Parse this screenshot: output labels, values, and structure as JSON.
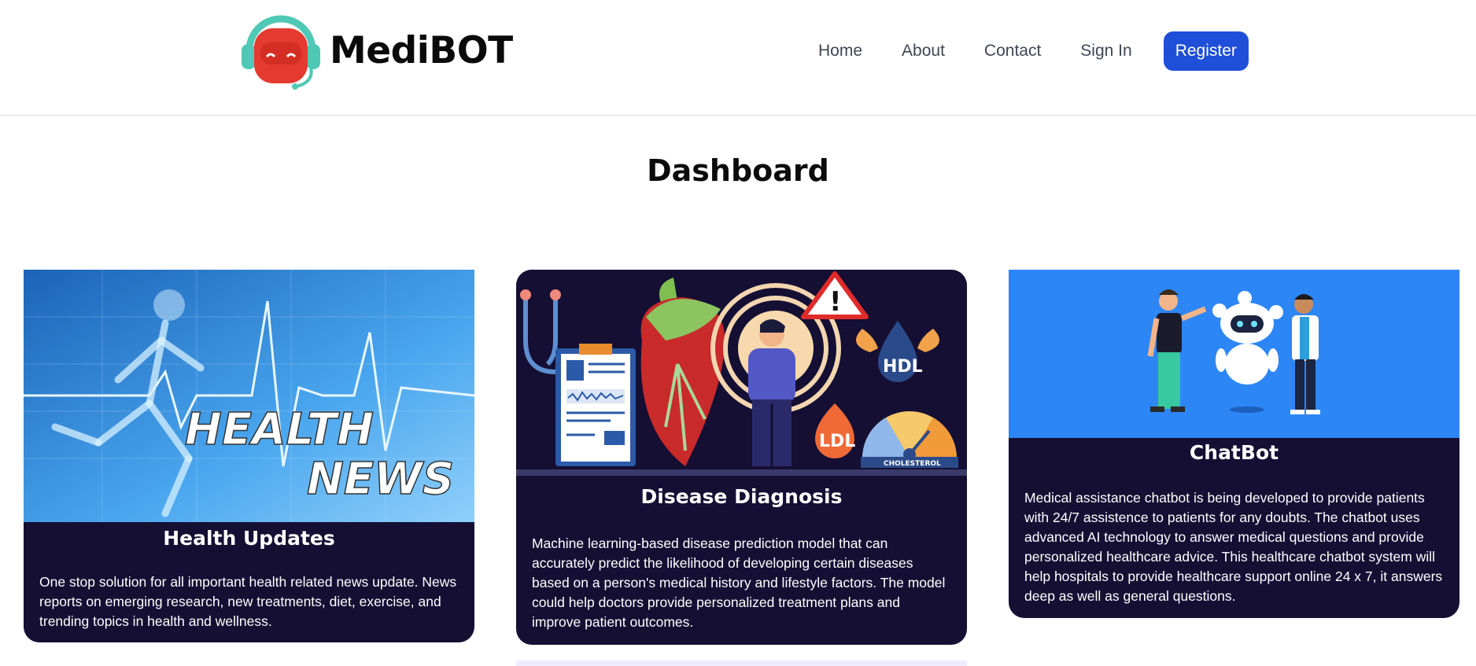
{
  "brand": {
    "name": "MediBOT",
    "logo_icon": "robot-headset-icon"
  },
  "nav": {
    "links": [
      "Home",
      "About",
      "Contact",
      "Sign In"
    ],
    "register_label": "Register",
    "register_color": "#1f4fd8"
  },
  "page": {
    "title": "Dashboard"
  },
  "cards": [
    {
      "title": "Health Updates",
      "image_text": [
        "HEALTH",
        "NEWS"
      ],
      "text": "One stop solution for all important health related news update. News reports on emerging research, new treatments, diet, exercise, and trending topics in health and wellness."
    },
    {
      "title": "Disease Diagnosis",
      "image_labels": [
        "HDL",
        "LDL",
        "CHOLESTEROL"
      ],
      "text": "Machine learning-based disease prediction model that can accurately predict the likelihood of developing certain diseases based on a person's medical history and lifestyle factors. The model could help doctors provide personalized treatment plans and improve patient outcomes."
    },
    {
      "title": "ChatBot",
      "text": "Medical assistance chatbot is being developed to provide patients with 24/7 assistence to patients for any doubts. The chatbot uses advanced AI technology to answer medical questions and provide personalized healthcare advice. This healthcare chatbot system will help hospitals to provide healthcare support online 24 x 7, it answers deep as well as general questions."
    }
  ],
  "colors": {
    "card_bg": "#140f33",
    "accent": "#1f4fd8",
    "chatbot_bg": "#2d86f5"
  }
}
